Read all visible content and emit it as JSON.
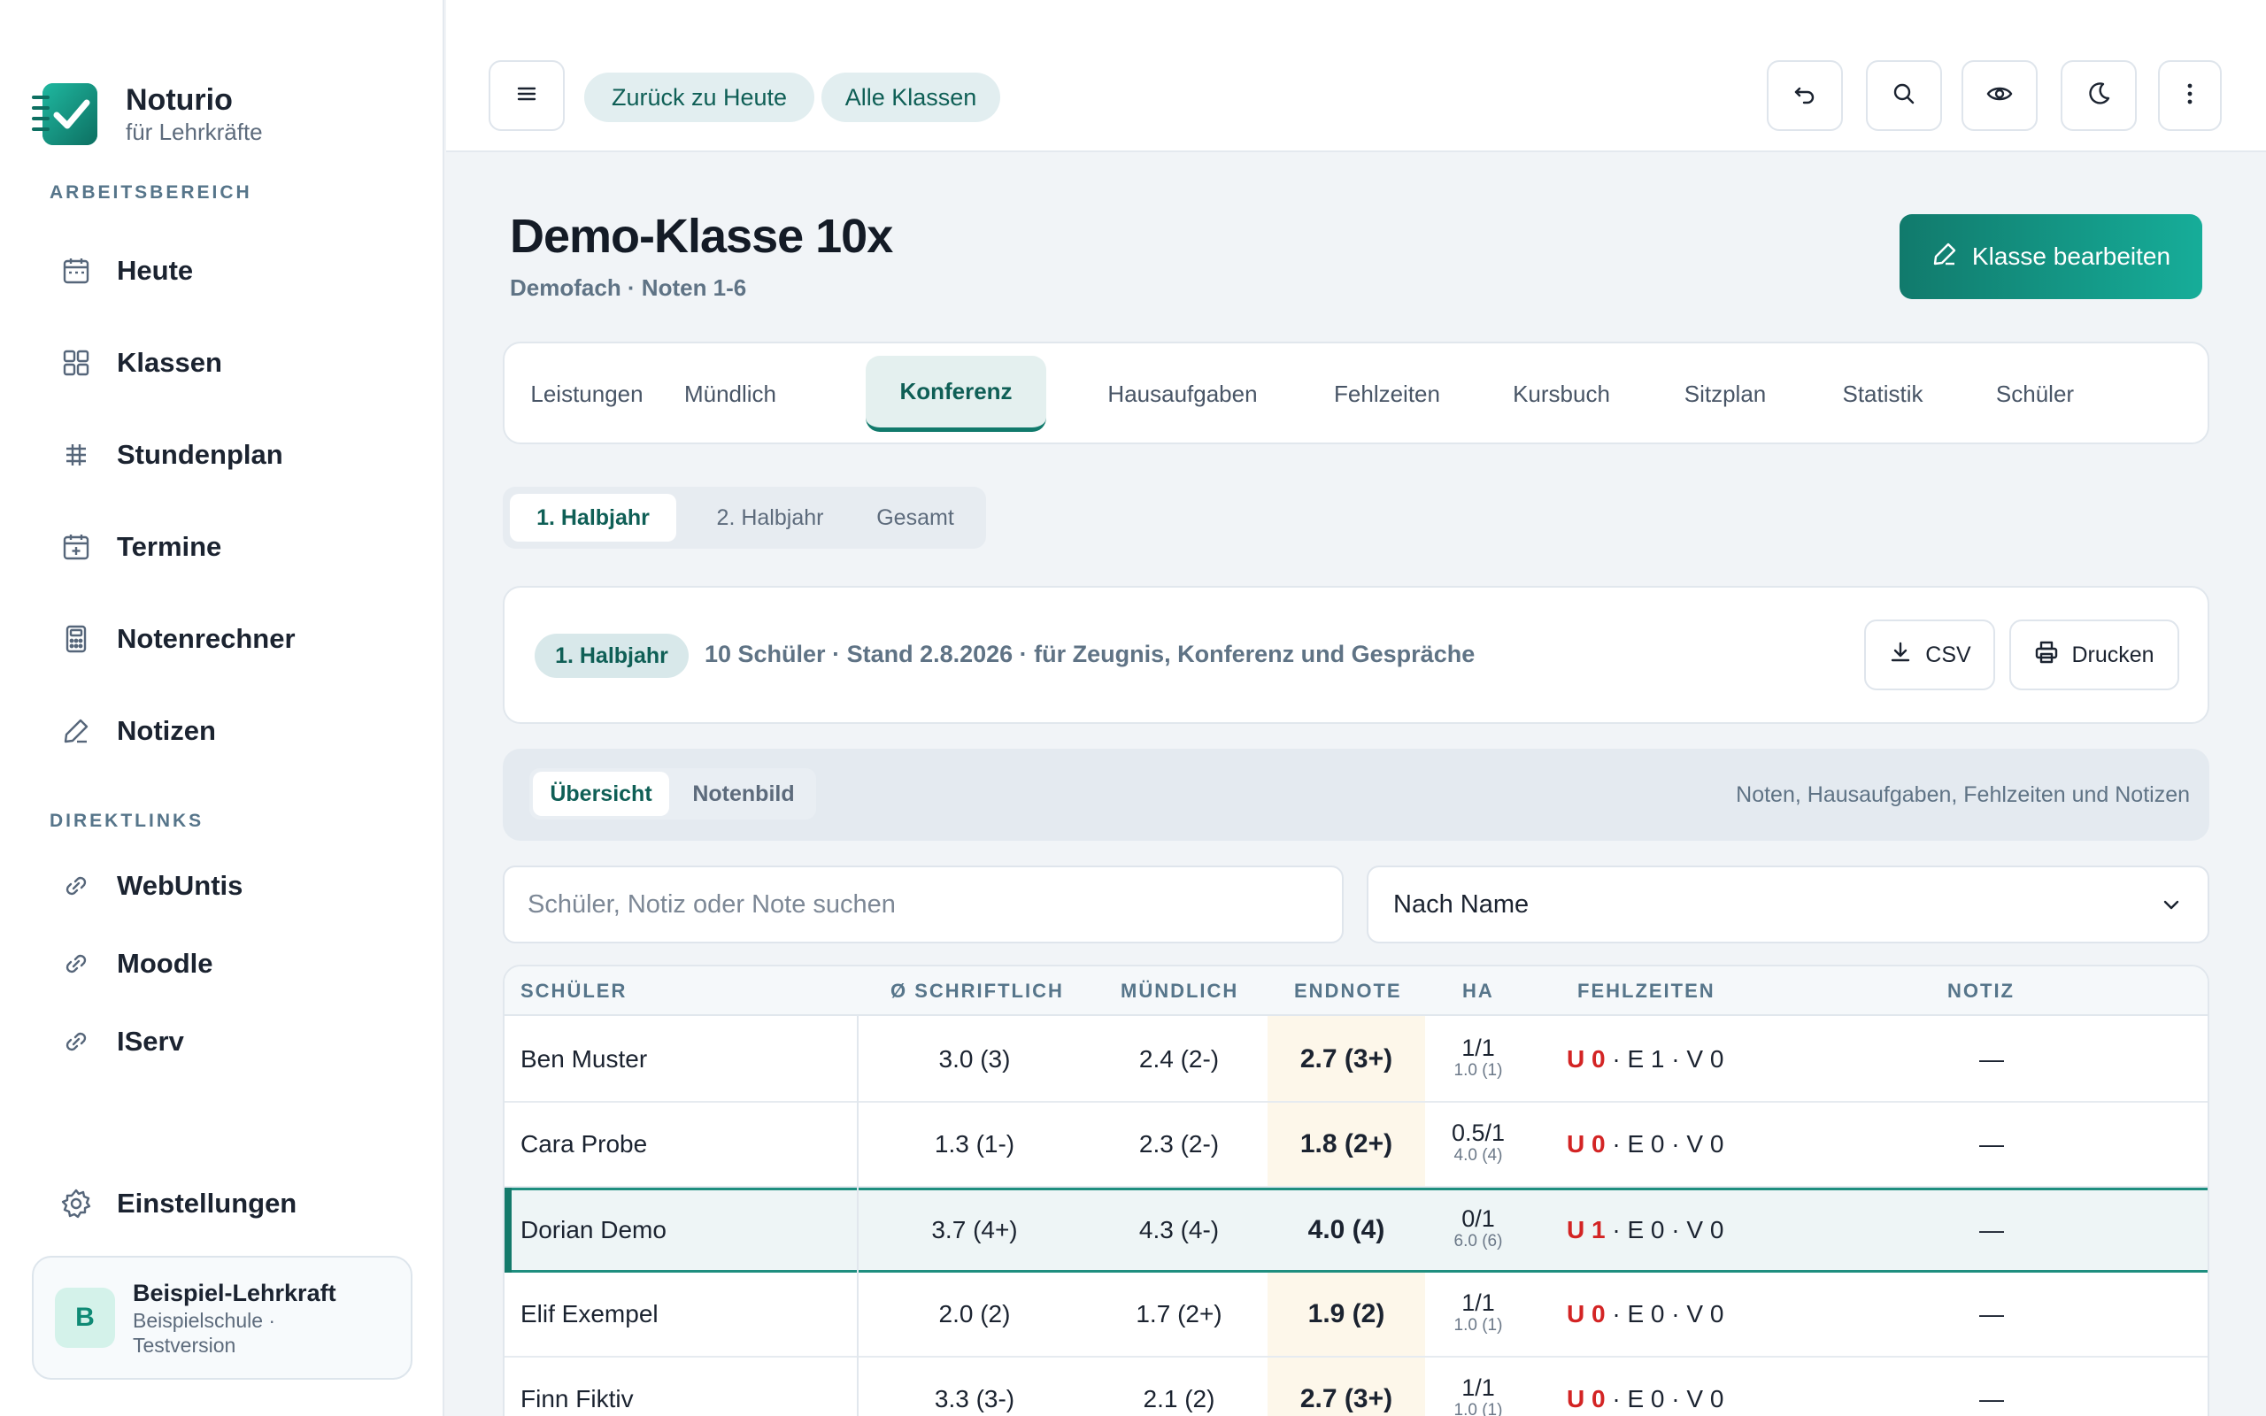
{
  "brand": {
    "name": "Noturio",
    "subtitle": "für Lehrkräfte"
  },
  "sidebar": {
    "section_workspace": "ARBEITSBEREICH",
    "items": [
      {
        "label": "Heute",
        "icon": "calendar-icon"
      },
      {
        "label": "Klassen",
        "icon": "grid-icon"
      },
      {
        "label": "Stundenplan",
        "icon": "timetable-icon"
      },
      {
        "label": "Termine",
        "icon": "calendar-plus-icon"
      },
      {
        "label": "Notenrechner",
        "icon": "calculator-icon"
      },
      {
        "label": "Notizen",
        "icon": "pencil-icon"
      }
    ],
    "section_links": "DIREKTLINKS",
    "links": [
      {
        "label": "WebUntis",
        "icon": "link-icon"
      },
      {
        "label": "Moodle",
        "icon": "link-icon"
      },
      {
        "label": "IServ",
        "icon": "link-icon"
      }
    ],
    "settings_label": "Einstellungen",
    "user": {
      "initial": "B",
      "name": "Beispiel-Lehrkraft",
      "school_line1": "Beispielschule ·",
      "school_line2": "Testversion"
    }
  },
  "topbar": {
    "back_today": "Zurück zu Heute",
    "all_classes": "Alle Klassen"
  },
  "page": {
    "title": "Demo-Klasse 10x",
    "subtitle": "Demofach · Noten 1-6",
    "edit_button": "Klasse bearbeiten"
  },
  "tabs": [
    "Leistungen",
    "Mündlich",
    "Konferenz",
    "Hausaufgaben",
    "Fehlzeiten",
    "Kursbuch",
    "Sitzplan",
    "Statistik",
    "Schüler"
  ],
  "active_tab": "Konferenz",
  "periods": [
    "1. Halbjahr",
    "2. Halbjahr",
    "Gesamt"
  ],
  "info": {
    "badge": "1. Halbjahr",
    "text": "10 Schüler · Stand 2.8.2026 · für Zeugnis, Konferenz und Gespräche",
    "csv_label": "CSV",
    "print_label": "Drucken"
  },
  "view": {
    "items": [
      "Übersicht",
      "Notenbild"
    ],
    "hint": "Noten, Hausaufgaben, Fehlzeiten und Notizen"
  },
  "search": {
    "placeholder": "Schüler, Notiz oder Note suchen"
  },
  "sort": {
    "value": "Nach Name"
  },
  "table": {
    "headers": {
      "student": "SCHÜLER",
      "written": "Ø SCHRIFTLICH",
      "oral": "MÜNDLICH",
      "final": "ENDNOTE",
      "ha": "HA",
      "absence": "FEHLZEITEN",
      "note": "NOTIZ"
    },
    "rows": [
      {
        "name": "Ben Muster",
        "written": "3.0 (3)",
        "oral": "2.4 (2-)",
        "final": "2.7 (3+)",
        "ha_main": "1/1",
        "ha_sub": "1.0 (1)",
        "u": "U 0",
        "rest": " · E 1 · V 0",
        "note": "—"
      },
      {
        "name": "Cara Probe",
        "written": "1.3 (1-)",
        "oral": "2.3 (2-)",
        "final": "1.8 (2+)",
        "ha_main": "0.5/1",
        "ha_sub": "4.0 (4)",
        "u": "U 0",
        "rest": " · E 0 · V 0",
        "note": "—"
      },
      {
        "name": "Dorian Demo",
        "written": "3.7 (4+)",
        "oral": "4.3 (4-)",
        "final": "4.0 (4)",
        "ha_main": "0/1",
        "ha_sub": "6.0 (6)",
        "u": "U 1",
        "rest": " · E 0 · V 0",
        "note": "—"
      },
      {
        "name": "Elif Exempel",
        "written": "2.0 (2)",
        "oral": "1.7 (2+)",
        "final": "1.9 (2)",
        "ha_main": "1/1",
        "ha_sub": "1.0 (1)",
        "u": "U 0",
        "rest": " · E 0 · V 0",
        "note": "—"
      },
      {
        "name": "Finn Fiktiv",
        "written": "3.3 (3-)",
        "oral": "2.1 (2)",
        "final": "2.7 (3+)",
        "ha_main": "1/1",
        "ha_sub": "1.0 (1)",
        "u": "U 0",
        "rest": " · E 0 · V 0",
        "note": "—"
      }
    ]
  },
  "colors": {
    "accent": "#117a6c",
    "absence_red": "#d32424",
    "final_bg": "#fdf7ea"
  }
}
